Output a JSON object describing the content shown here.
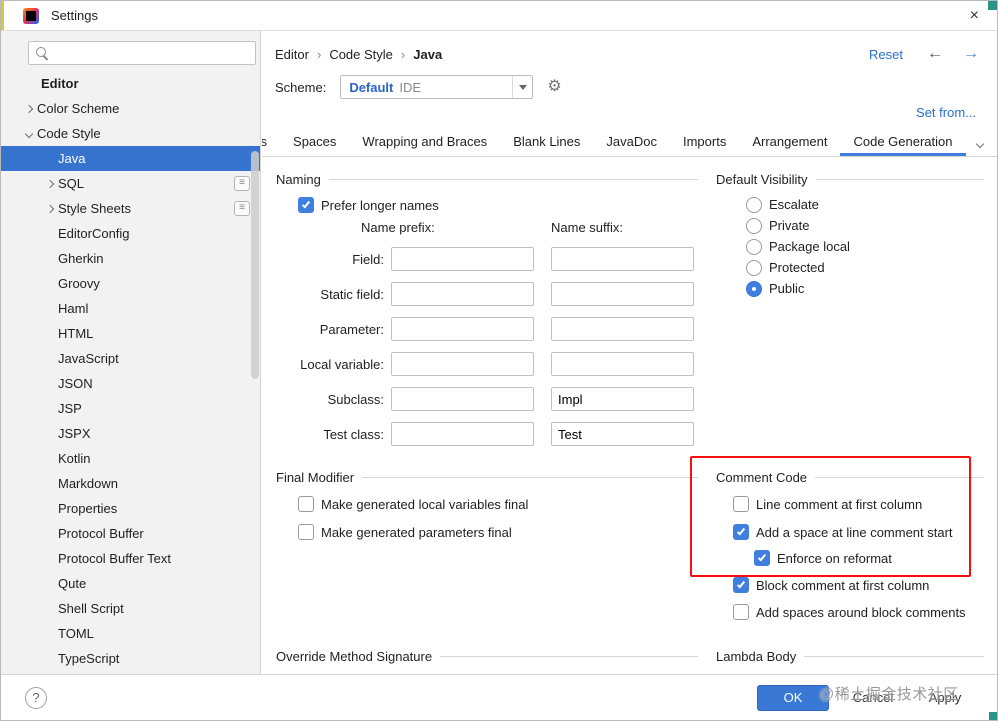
{
  "window": {
    "title": "Settings"
  },
  "icons": {
    "close": "×",
    "gear": "⚙",
    "back": "←",
    "forward": "→",
    "help": "?",
    "list": "≡",
    "breadcrumb_sep": "›"
  },
  "colors": {
    "selection_blue": "#3674d0",
    "accent_blue": "#3e7fe0",
    "tab_underline": "#3f7ede",
    "link_blue": "#2a6fc8",
    "annotation_red": "#f50f0f"
  },
  "sidebar": {
    "search_value": "",
    "items": [
      {
        "label": "Editor"
      },
      {
        "label": "Color Scheme"
      },
      {
        "label": "Code Style"
      },
      {
        "label": "Java",
        "selected": true
      },
      {
        "label": "SQL"
      },
      {
        "label": "Style Sheets"
      },
      {
        "label": "EditorConfig"
      },
      {
        "label": "Gherkin"
      },
      {
        "label": "Groovy"
      },
      {
        "label": "Haml"
      },
      {
        "label": "HTML"
      },
      {
        "label": "JavaScript"
      },
      {
        "label": "JSON"
      },
      {
        "label": "JSP"
      },
      {
        "label": "JSPX"
      },
      {
        "label": "Kotlin"
      },
      {
        "label": "Markdown"
      },
      {
        "label": "Properties"
      },
      {
        "label": "Protocol Buffer"
      },
      {
        "label": "Protocol Buffer Text"
      },
      {
        "label": "Qute"
      },
      {
        "label": "Shell Script"
      },
      {
        "label": "TOML"
      },
      {
        "label": "TypeScript"
      }
    ]
  },
  "header": {
    "breadcrumb": [
      "Editor",
      "Code Style",
      "Java"
    ],
    "reset": "Reset",
    "scheme_label": "Scheme:",
    "scheme_value": "Default",
    "scheme_tag": "IDE",
    "set_from": "Set from..."
  },
  "tabs": {
    "items": [
      {
        "label": "Tabs and Indents"
      },
      {
        "label": "Spaces"
      },
      {
        "label": "Wrapping and Braces"
      },
      {
        "label": "Blank Lines"
      },
      {
        "label": "JavaDoc"
      },
      {
        "label": "Imports"
      },
      {
        "label": "Arrangement"
      },
      {
        "label": "Code Generation",
        "selected": true
      }
    ]
  },
  "naming": {
    "title": "Naming",
    "prefer_longer_names": {
      "label": "Prefer longer names",
      "checked": true
    },
    "col_prefix": "Name prefix:",
    "col_suffix": "Name suffix:",
    "rows": [
      {
        "label": "Field:",
        "prefix": "",
        "suffix": ""
      },
      {
        "label": "Static field:",
        "prefix": "",
        "suffix": ""
      },
      {
        "label": "Parameter:",
        "prefix": "",
        "suffix": ""
      },
      {
        "label": "Local variable:",
        "prefix": "",
        "suffix": ""
      },
      {
        "label": "Subclass:",
        "prefix": "",
        "suffix": "Impl"
      },
      {
        "label": "Test class:",
        "prefix": "",
        "suffix": "Test"
      }
    ]
  },
  "default_visibility": {
    "title": "Default Visibility",
    "options": [
      {
        "label": "Escalate",
        "selected": false
      },
      {
        "label": "Private",
        "selected": false
      },
      {
        "label": "Package local",
        "selected": false
      },
      {
        "label": "Protected",
        "selected": false
      },
      {
        "label": "Public",
        "selected": true
      }
    ]
  },
  "final_modifier": {
    "title": "Final Modifier",
    "options": [
      {
        "label": "Make generated local variables final",
        "checked": false
      },
      {
        "label": "Make generated parameters final",
        "checked": false
      }
    ]
  },
  "comment_code": {
    "title": "Comment Code",
    "options": [
      {
        "label": "Line comment at first column",
        "checked": false
      },
      {
        "label": "Add a space at line comment start",
        "checked": true
      },
      {
        "label": "Enforce on reformat",
        "checked": true,
        "indented": true
      },
      {
        "label": "Block comment at first column",
        "checked": true
      },
      {
        "label": "Add spaces around block comments",
        "checked": false
      }
    ]
  },
  "override_method_signature": {
    "title": "Override Method Signature"
  },
  "lambda_body": {
    "title": "Lambda Body"
  },
  "footer": {
    "ok": "OK",
    "cancel": "Cancel",
    "apply": "Apply",
    "watermark": "@稀土掘金技术社区"
  }
}
